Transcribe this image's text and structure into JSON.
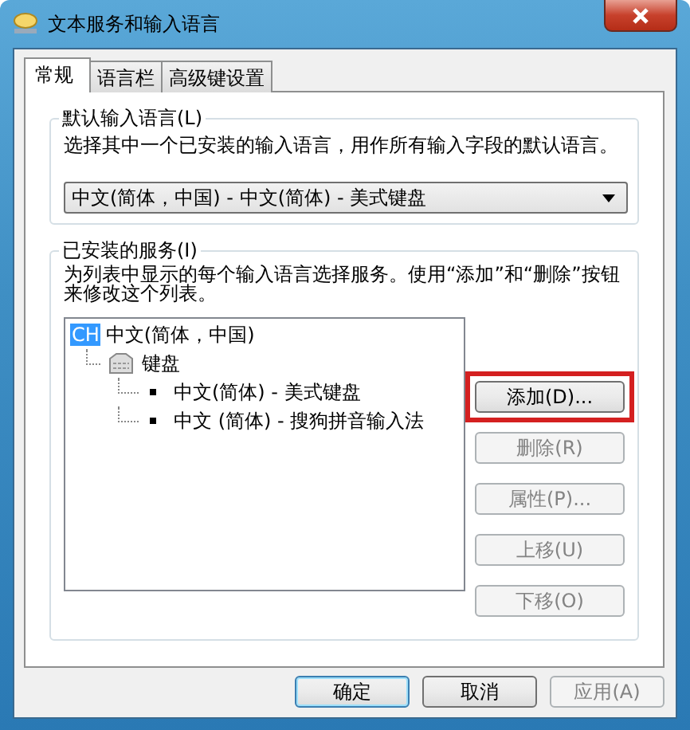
{
  "window": {
    "title": "文本服务和输入语言"
  },
  "tabs": [
    {
      "label": "常规",
      "selected": true
    },
    {
      "label": "语言栏",
      "selected": false
    },
    {
      "label": "高级键设置",
      "selected": false
    }
  ],
  "default_language": {
    "legend": "默认输入语言(L)",
    "description": "选择其中一个已安装的输入语言，用作所有输入字段的默认语言。",
    "dropdown": {
      "value": "中文(简体，中国) - 中文(简体) - 美式键盘"
    }
  },
  "installed_services": {
    "legend": "已安装的服务(I)",
    "description": "为列表中显示的每个输入语言选择服务。使用“添加”和“删除”按钮来修改这个列表。",
    "tree": [
      {
        "badge": "CH",
        "label": "中文(简体，中国)",
        "children": [
          {
            "label": "键盘",
            "children": [
              {
                "label": "中文(简体) - 美式键盘"
              },
              {
                "label": "中文 (简体) - 搜狗拼音输入法"
              }
            ]
          }
        ]
      }
    ],
    "buttons": [
      {
        "label": "添加(D)...",
        "disabled": false,
        "highlighted": true
      },
      {
        "label": "删除(R)",
        "disabled": true,
        "highlighted": false
      },
      {
        "label": "属性(P)...",
        "disabled": true,
        "highlighted": false
      },
      {
        "label": "上移(U)",
        "disabled": true,
        "highlighted": false
      },
      {
        "label": "下移(O)",
        "disabled": true,
        "highlighted": false
      }
    ]
  },
  "footer_buttons": [
    {
      "label": "确定",
      "default": true,
      "disabled": false
    },
    {
      "label": "取消",
      "default": false,
      "disabled": false
    },
    {
      "label": "应用(A)",
      "disabled": true,
      "default": false
    }
  ]
}
